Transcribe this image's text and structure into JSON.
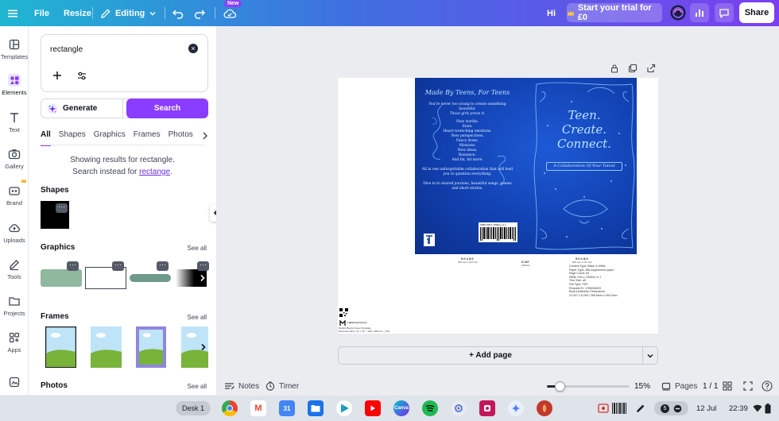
{
  "topbar": {
    "file": "File",
    "resize": "Resize",
    "editing": "Editing",
    "new_badge": "New",
    "greeting": "Hi",
    "trial": "Start your trial for £0",
    "share": "Share"
  },
  "rail": {
    "items": [
      {
        "label": "Templates"
      },
      {
        "label": "Elements"
      },
      {
        "label": "Text"
      },
      {
        "label": "Gallery"
      },
      {
        "label": "Brand"
      },
      {
        "label": "Uploads"
      },
      {
        "label": "Tools"
      },
      {
        "label": "Projects"
      },
      {
        "label": "Apps"
      }
    ]
  },
  "panel": {
    "search_value": "rectangle",
    "generate": "Generate",
    "search": "Search",
    "tabs": [
      "All",
      "Shapes",
      "Graphics",
      "Frames",
      "Photos"
    ],
    "msg_line1": "Showing results for rectangle.",
    "msg_line2_prefix": "Search instead for",
    "msg_line2_link": "rectange",
    "msg_line2_suffix": ".",
    "sections": {
      "shapes": "Shapes",
      "graphics": "Graphics",
      "frames": "Frames",
      "photos": "Photos"
    },
    "see_all": "See all",
    "more": "···",
    "colors": {
      "accent": "#8b3dff",
      "graphic_green": "#8fb89e",
      "graphic_teal": "#6e9a8c"
    }
  },
  "cover": {
    "back_head": "Made By Teens, For Teens",
    "back_lines": [
      "You're never too young to create something",
      "beautiful.",
      "These girls prove it.",
      "",
      "New worlds.",
      "Stars.",
      "Heart-wrenching emotions.",
      "New perspectives.",
      "Fancy dress.",
      "Missions.",
      "New ideas.",
      "Romance.",
      "And fat, fat more.",
      "",
      "All in one unforgettable collaboration that will lead",
      "you to question everything.",
      "",
      "Dive in to shared journies, beautiful songs, poems",
      "and short stories."
    ],
    "barcode_label": "ISBN 978-1-7845xx-xx-x",
    "front_title_1": "Teen.",
    "front_title_2": "Create.",
    "front_title_3": "Connect.",
    "front_sub": "A Collaboration Of Your Talent",
    "spec_left_1": "5.0 x 8.0",
    "spec_left_2": "203 mm x 127 mm",
    "spec_mid_1": "0.157",
    "spec_mid_2": "3.99mm",
    "spec_right_1": "5.0 x 8.0",
    "spec_right_2": "203 mm x 127 mm",
    "spec_lines": [
      "Content Type: Black & White",
      "Paper Type: 28# supplement paper",
      "Page Count: 64",
      "ISBN: 978-1-7845XX-X-7",
      "Trim Size: a5",
      "File Type: PDF",
      "Request ID: 1765036003",
      "Board Adhesive Dimensions:",
      "10.437 x 8.250 / 265.8mm x 264.0mm"
    ],
    "footer_brand": "Lightning Source",
    "footer_note_1": "Perfect Bound Cover Template",
    "footer_note_2": "Document Size: 12\" x 11\" · 305 x 280 mm · (TS)"
  },
  "canvas": {
    "add_page": "+ Add page"
  },
  "footer": {
    "notes": "Notes",
    "timer": "Timer",
    "zoom_fraction": 0.15,
    "zoom": "15%",
    "pages": "Pages",
    "page_count": "1 / 1"
  },
  "taskbar": {
    "desk": "Desk 1",
    "date": "12 Jul",
    "time": "22:39",
    "notification_count": "5"
  }
}
